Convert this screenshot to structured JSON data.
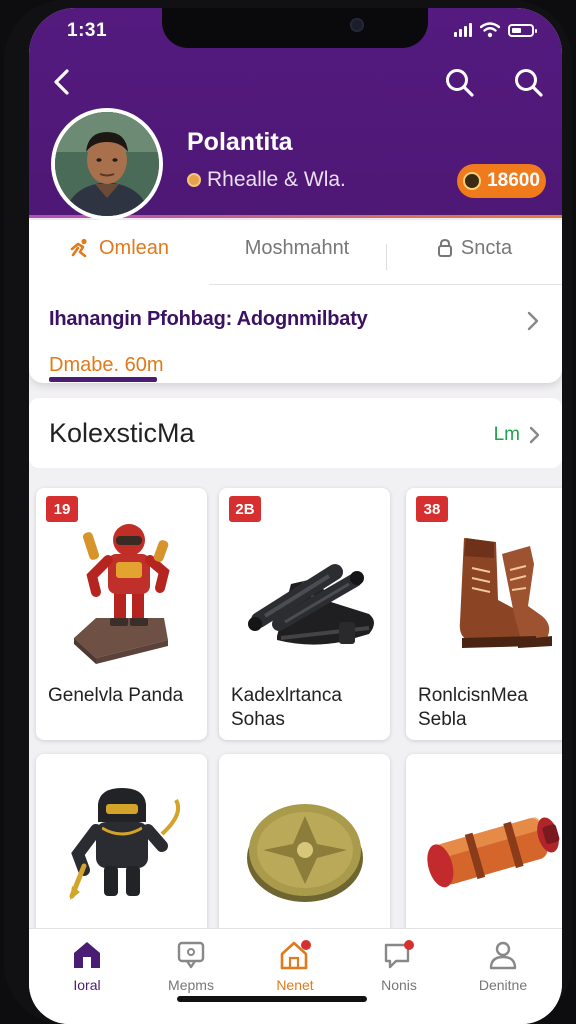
{
  "status_bar": {
    "time": "1:31"
  },
  "profile": {
    "name": "Polantita",
    "subtitle": "Rhealle & Wla.",
    "coins": "18600"
  },
  "tabs": [
    {
      "label": "Omlean",
      "active": true
    },
    {
      "label": "Moshmahnt",
      "active": false
    },
    {
      "label": "Sncta",
      "active": false
    }
  ],
  "progress": {
    "title": "Ihanangin Pfohbag: Adognmilbaty",
    "distance": "Dmabe. 60m",
    "fraction": 0.22
  },
  "collection": {
    "title": "KolexsticMa",
    "more_label": "Lm",
    "items": [
      {
        "badge": "19",
        "name": "Genelvla Panda",
        "icon": "robot-figure-icon"
      },
      {
        "badge": "2B",
        "name": "Kadexlrtanca Sohas",
        "icon": "boots-icon"
      },
      {
        "badge": "38",
        "name": "RonlcisnMea Sebla",
        "icon": "leather-boots-icon"
      },
      {
        "badge": "",
        "name": "",
        "icon": "armored-knight-icon"
      },
      {
        "badge": "",
        "name": "",
        "icon": "bronze-shield-icon"
      },
      {
        "badge": "",
        "name": "",
        "icon": "canister-icon"
      }
    ]
  },
  "bottom_nav": [
    {
      "label": "Ioral",
      "icon": "home-icon",
      "active": true
    },
    {
      "label": "Mepms",
      "icon": "message-icon",
      "active": false
    },
    {
      "label": "Nenet",
      "icon": "house-badge-icon",
      "active": false
    },
    {
      "label": "Nonis",
      "icon": "chat-badge-icon",
      "active": false
    },
    {
      "label": "Denitne",
      "icon": "profile-icon",
      "active": false
    }
  ],
  "colors": {
    "header": "#541a7f",
    "accent_orange": "#ef7b1d",
    "accent_green": "#1ea34a",
    "badge_red": "#d62f2f"
  }
}
